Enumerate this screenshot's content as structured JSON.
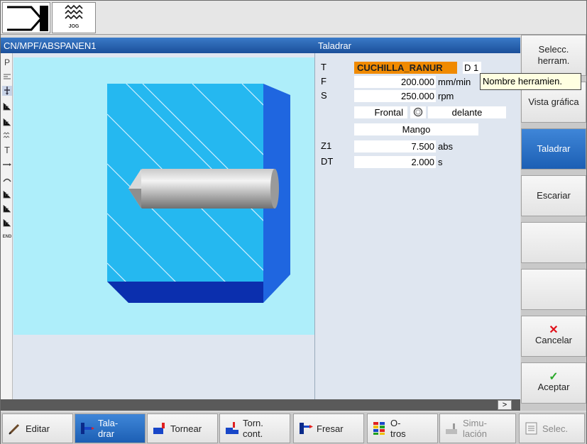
{
  "topbar": {
    "mode_label": "JOG"
  },
  "header": {
    "program_path": "CN/MPF/ABSPANEN1",
    "title": "Taladrar"
  },
  "params": {
    "t": {
      "label": "T",
      "value": "CUCHILLA_RANUR",
      "d_label": "D",
      "d_value": "1"
    },
    "f": {
      "label": "F",
      "value": "200.000",
      "unit": "mm/min"
    },
    "s": {
      "label": "S",
      "value": "250.000",
      "unit": "rpm"
    },
    "face": {
      "value": "Frontal",
      "side": "delante"
    },
    "holder": {
      "value": "Mango"
    },
    "z1": {
      "label": "Z1",
      "value": "7.500",
      "unit": "abs"
    },
    "dt": {
      "label": "DT",
      "value": "2.000",
      "unit": "s"
    }
  },
  "tooltip": "Nombre herramien.",
  "softkeys_right": {
    "select_tool": "Selecc. herram.",
    "graphic_view": "Vista gráfica",
    "drill": "Taladrar",
    "ream": "Escariar",
    "cancel": "Cancelar",
    "accept": "Aceptar"
  },
  "softkeys_bottom": {
    "edit": "Editar",
    "drill": "Tala-\ndrar",
    "turn": "Tornear",
    "turn_contour": "Torn.\ncont.",
    "mill": "Fresar",
    "others": "O-\ntros",
    "simulation": "Simu-\nlación",
    "select": "Selec."
  },
  "scroll_arrow": ">",
  "icon_strip": [
    "P",
    "T",
    "END"
  ],
  "colors": {
    "header_blue": "#1b4f9a",
    "active_softkey": "#2a6fc4",
    "tool_highlight": "#f08a00",
    "graphic_bg": "#aeeefa",
    "workpiece_face": "#25b8f0",
    "workpiece_side": "#1f66e0",
    "workpiece_bottom": "#0b2fae"
  }
}
